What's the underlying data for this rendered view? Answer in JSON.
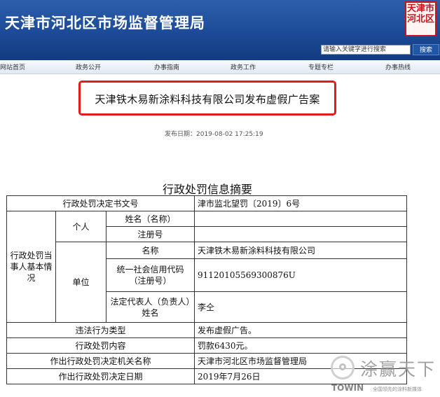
{
  "header": {
    "site_title": "天津市河北区市场监督管理局",
    "seal_text": "天津市河北区",
    "search": {
      "value": "请输入关键字进行搜索",
      "button_label": "搜索"
    }
  },
  "nav": {
    "items": [
      "网站首页",
      "政务公开",
      "办事指南",
      "政务工作",
      "专题专栏",
      "办事热线"
    ]
  },
  "article": {
    "title": "天津铁木易新涂料科技有限公司发布虚假广告案",
    "publish_date": "发布日期：2019-08-02 17:25:19"
  },
  "summary": {
    "title": "行政处罚信息摘要",
    "rows": {
      "doc_no_label": "行政处罚决定书文号",
      "doc_no_value": "津市监北望罚〔2019〕6号",
      "party_label": "行政处罚当事人基本情况",
      "individual_label": "个人",
      "name_label": "姓名（名称）",
      "reg_no_label": "注册号",
      "unit_label": "单位",
      "unit_name_label": "名称",
      "unit_name_value": "天津铁木易新涂料科技有限公司",
      "credit_code_label": "统一社会信用代码（注册号）",
      "credit_code_value": "91120105569300876U",
      "legal_rep_label": "法定代表人（负责人）姓名",
      "legal_rep_value": "李仝",
      "violation_type_label": "违法行为类型",
      "violation_type_value": "发布虚假广告。",
      "penalty_content_label": "行政处罚内容",
      "penalty_content_value": "罚款6430元。",
      "authority_label": "作出行政处罚决定机关名称",
      "authority_value": "天津市河北区市场监督管理局",
      "date_label": "作出行政处罚决定日期",
      "date_value": "2019年7月26日"
    }
  },
  "watermark": {
    "name": "涂赢天下",
    "brand": "TOWIN",
    "slogan": "全国领先的涂料新媒体"
  }
}
